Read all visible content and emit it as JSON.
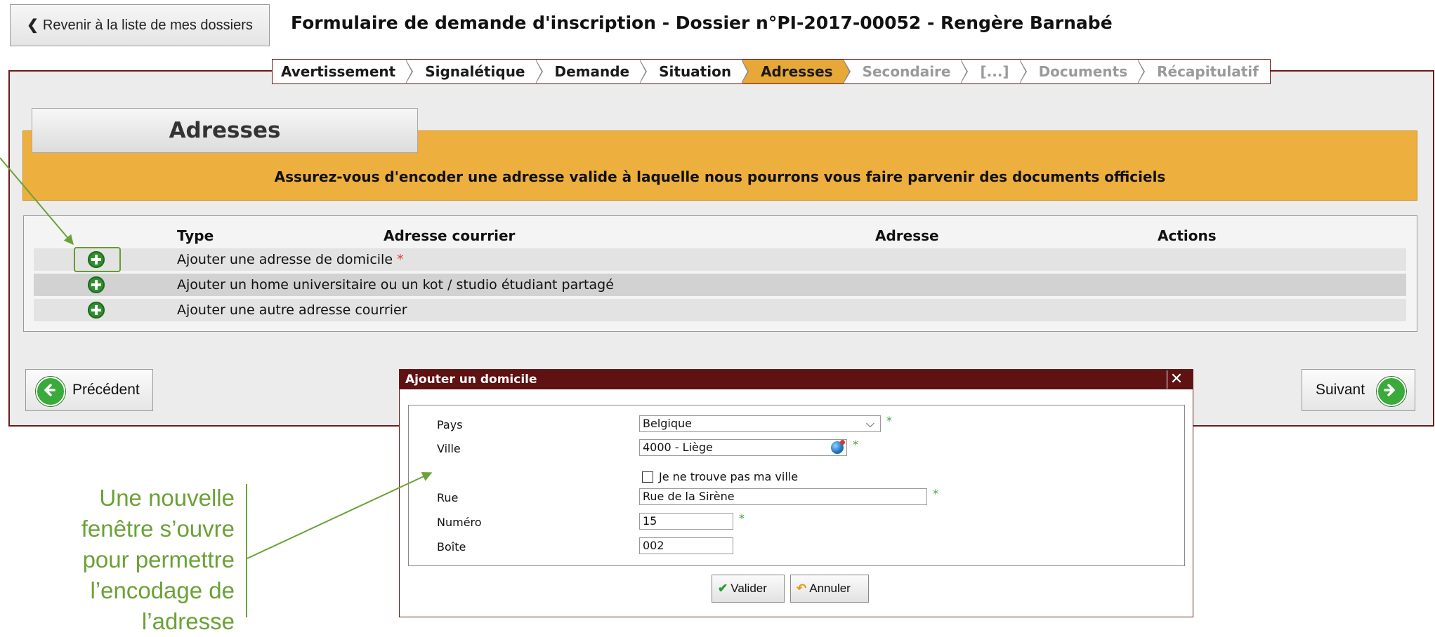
{
  "header": {
    "back_label": "Revenir à la liste de mes dossiers",
    "title": "Formulaire de demande d'inscription - Dossier n°PI-2017-00052 - Rengère Barnabé"
  },
  "stepper": {
    "steps": [
      {
        "label": "Avertissement",
        "state": "done"
      },
      {
        "label": "Signalétique",
        "state": "done"
      },
      {
        "label": "Demande",
        "state": "done"
      },
      {
        "label": "Situation",
        "state": "done"
      },
      {
        "label": "Adresses",
        "state": "active"
      },
      {
        "label": "Secondaire",
        "state": "disabled"
      },
      {
        "label": "[...]",
        "state": "disabled"
      },
      {
        "label": "Documents",
        "state": "disabled"
      },
      {
        "label": "Récapitulatif",
        "state": "disabled"
      }
    ]
  },
  "section": {
    "title": "Adresses",
    "notice": "Assurez-vous d'encoder une adresse valide à laquelle nous pourrons vous faire parvenir des documents officiels"
  },
  "table": {
    "headers": {
      "type": "Type",
      "mail": "Adresse courrier",
      "address": "Adresse",
      "actions": "Actions"
    },
    "rows": [
      {
        "label": "Ajouter une adresse de domicile",
        "required": "*"
      },
      {
        "label": "Ajouter un home universitaire ou un kot / studio étudiant partagé"
      },
      {
        "label": "Ajouter une autre adresse courrier"
      }
    ]
  },
  "nav": {
    "prev_label": "Précédent",
    "next_label": "Suivant"
  },
  "modal": {
    "title": "Ajouter un domicile",
    "close_glyph": "✕",
    "required_mark": "*",
    "fields": {
      "pays": {
        "label": "Pays",
        "value": "Belgique"
      },
      "ville": {
        "label": "Ville",
        "value": "4000 - Liège"
      },
      "not_found": {
        "label": "Je ne trouve pas ma ville",
        "checked": false
      },
      "rue": {
        "label": "Rue",
        "value": "Rue de la Sirène"
      },
      "numero": {
        "label": "Numéro",
        "value": "15"
      },
      "boite": {
        "label": "Boîte",
        "value": "002"
      }
    },
    "buttons": {
      "validate": "Valider",
      "cancel": "Annuler"
    }
  },
  "annotation": {
    "lines": [
      "Une nouvelle",
      "fenêtre s’ouvre",
      "pour permettre",
      "l’encodage de",
      "l’adresse"
    ]
  },
  "colors": {
    "accent": "#edaf3d",
    "frame": "#6b1a1a",
    "modal_bar": "#5e1212",
    "annotation": "#6aa236"
  }
}
